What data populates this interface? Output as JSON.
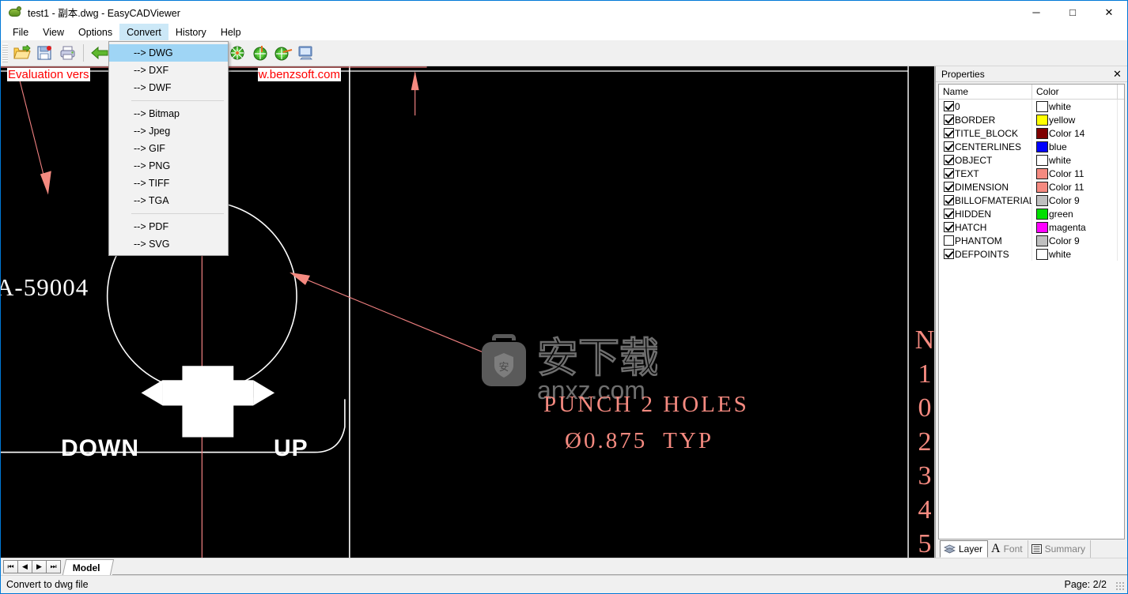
{
  "window": {
    "title": "test1 - 副本.dwg - EasyCADViewer",
    "app_icon": "turtle-icon",
    "minimize_label": "─",
    "maximize_label": "□",
    "close_label": "✕"
  },
  "menubar": {
    "items": [
      {
        "label": "File",
        "active": false
      },
      {
        "label": "View",
        "active": false
      },
      {
        "label": "Options",
        "active": false
      },
      {
        "label": "Convert",
        "active": true
      },
      {
        "label": "History",
        "active": false
      },
      {
        "label": "Help",
        "active": false
      }
    ]
  },
  "convert_menu": {
    "open": true,
    "groups": [
      {
        "items": [
          {
            "label": "--> DWG",
            "selected": true
          },
          {
            "label": "--> DXF",
            "selected": false
          },
          {
            "label": "--> DWF",
            "selected": false
          }
        ]
      },
      {
        "items": [
          {
            "label": "--> Bitmap",
            "selected": false
          },
          {
            "label": "--> Jpeg",
            "selected": false
          },
          {
            "label": "--> GIF",
            "selected": false
          },
          {
            "label": "--> PNG",
            "selected": false
          },
          {
            "label": "--> TIFF",
            "selected": false
          },
          {
            "label": "--> TGA",
            "selected": false
          }
        ]
      },
      {
        "items": [
          {
            "label": "--> PDF",
            "selected": false
          },
          {
            "label": "--> SVG",
            "selected": false
          }
        ]
      }
    ]
  },
  "toolbar": {
    "buttons": [
      {
        "name": "open-file-icon"
      },
      {
        "name": "save-file-icon"
      },
      {
        "name": "print-icon"
      },
      {
        "name": "back-arrow-icon"
      },
      {
        "name": "forward-arrow-icon"
      },
      {
        "name": "pan-icon"
      },
      {
        "name": "zoom-window-icon"
      },
      {
        "name": "redo-icon"
      },
      {
        "name": "undo-icon"
      },
      {
        "name": "zoom-all-icon"
      },
      {
        "name": "zoom-in-icon"
      },
      {
        "name": "zoom-out-icon"
      },
      {
        "name": "layout-icon"
      }
    ]
  },
  "canvas": {
    "background_color": "#000000",
    "evaluation_banner": {
      "left_text": "Evaluation vers",
      "right_text": "w.benzsoft.com",
      "color": "#ff0000"
    },
    "watermark": {
      "logo_text": "安",
      "cn_text": "安下载",
      "site_text": "anxz.com",
      "color": "#585858"
    },
    "labels": {
      "part_number": "A-59004",
      "down": "DOWN",
      "up": "UP",
      "punch_note": "PUNCH 2 HOLES",
      "diameter_note": "Ø0.875  TYP",
      "vertical_digits": "N\n1\n0\n2\n3\n4\n5"
    },
    "colors": {
      "geometry": "#ffffff",
      "annotation": "#f58a80",
      "centerline": "#f08080"
    }
  },
  "properties": {
    "title": "Properties",
    "close_label": "✕",
    "columns": {
      "name": "Name",
      "color": "Color"
    },
    "layers": [
      {
        "name": "0",
        "checked": true,
        "color_label": "white",
        "swatch": "#ffffff"
      },
      {
        "name": "BORDER",
        "checked": true,
        "color_label": "yellow",
        "swatch": "#ffff00"
      },
      {
        "name": "TITLE_BLOCK",
        "checked": true,
        "color_label": "Color 14",
        "swatch": "#7f0000"
      },
      {
        "name": "CENTERLINES",
        "checked": true,
        "color_label": "blue",
        "swatch": "#0000ff"
      },
      {
        "name": "OBJECT",
        "checked": true,
        "color_label": "white",
        "swatch": "#ffffff"
      },
      {
        "name": "TEXT",
        "checked": true,
        "color_label": "Color 11",
        "swatch": "#f58a80"
      },
      {
        "name": "DIMENSION",
        "checked": true,
        "color_label": "Color 11",
        "swatch": "#f58a80"
      },
      {
        "name": "BILLOFMATERIAL",
        "checked": true,
        "color_label": "Color 9",
        "swatch": "#bfbfbf"
      },
      {
        "name": "HIDDEN",
        "checked": true,
        "color_label": "green",
        "swatch": "#00e000"
      },
      {
        "name": "HATCH",
        "checked": true,
        "color_label": "magenta",
        "swatch": "#ff00ff"
      },
      {
        "name": "PHANTOM",
        "checked": false,
        "color_label": "Color 9",
        "swatch": "#bfbfbf"
      },
      {
        "name": "DEFPOINTS",
        "checked": true,
        "color_label": "white",
        "swatch": "#ffffff"
      }
    ],
    "tabs": [
      {
        "label": "Layer",
        "icon": "layers-icon",
        "active": true
      },
      {
        "label": "Font",
        "icon": "font-a-icon",
        "active": false
      },
      {
        "label": "Summary",
        "icon": "summary-icon",
        "active": false
      }
    ]
  },
  "sheet_tabs": {
    "nav": [
      {
        "name": "first-sheet-button",
        "label": "⏮"
      },
      {
        "name": "prev-sheet-button",
        "label": "◀"
      },
      {
        "name": "next-sheet-button",
        "label": "▶"
      },
      {
        "name": "last-sheet-button",
        "label": "⏭"
      }
    ],
    "tabs": [
      {
        "label": "Model",
        "active": true
      }
    ]
  },
  "statusbar": {
    "message": "Convert to dwg file",
    "page": "Page: 2/2"
  }
}
